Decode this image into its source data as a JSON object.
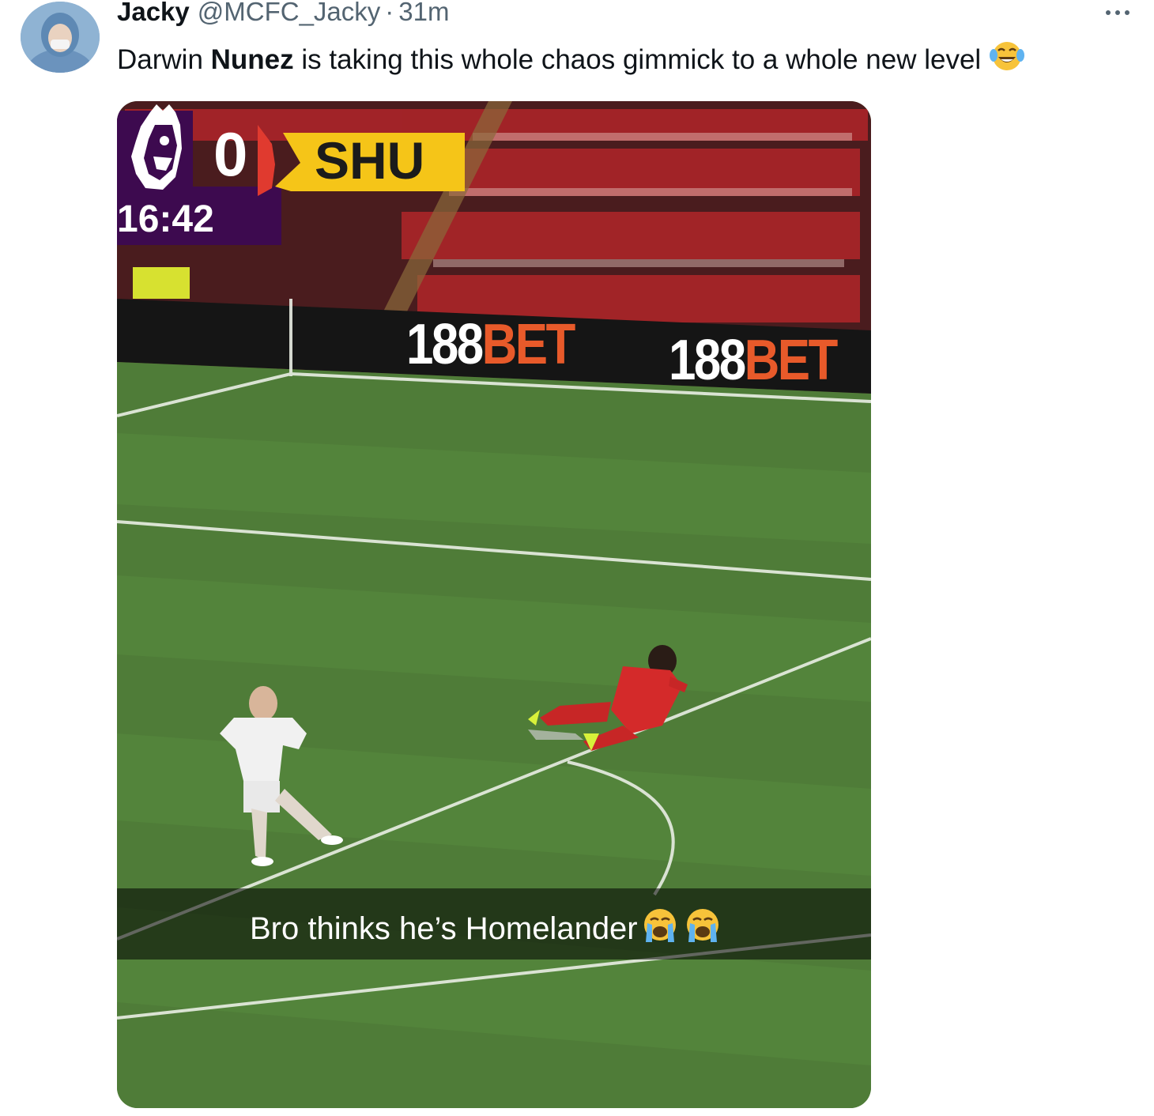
{
  "tweet": {
    "author_name": "Jacky",
    "handle": "@MCFC_Jacky",
    "separator": "·",
    "time": "31m",
    "text_before": "Darwin ",
    "text_bold": "Nunez",
    "text_after": " is taking this whole chaos gimmick to a whole new level",
    "text_emoji": "face-with-tears-of-joy-icon"
  },
  "media": {
    "scoreboard": {
      "home_score": "0",
      "away_team": "SHU",
      "clock": "16:42",
      "league_logo": "premier-league-lion-icon",
      "colors": {
        "purple": "#3d0a4f",
        "yellow": "#f5c518"
      }
    },
    "ad_boards": [
      {
        "white": "188",
        "orange": "BET"
      },
      {
        "white": "188",
        "orange": "BET"
      }
    ],
    "caption": {
      "text": "Bro thinks he’s Homelander",
      "emojis": [
        "loudly-crying-face-icon",
        "loudly-crying-face-icon"
      ]
    }
  },
  "colors": {
    "secondary_text": "#536471",
    "pitch_green": "#4d7a36",
    "accent_orange": "#e85a2a"
  }
}
